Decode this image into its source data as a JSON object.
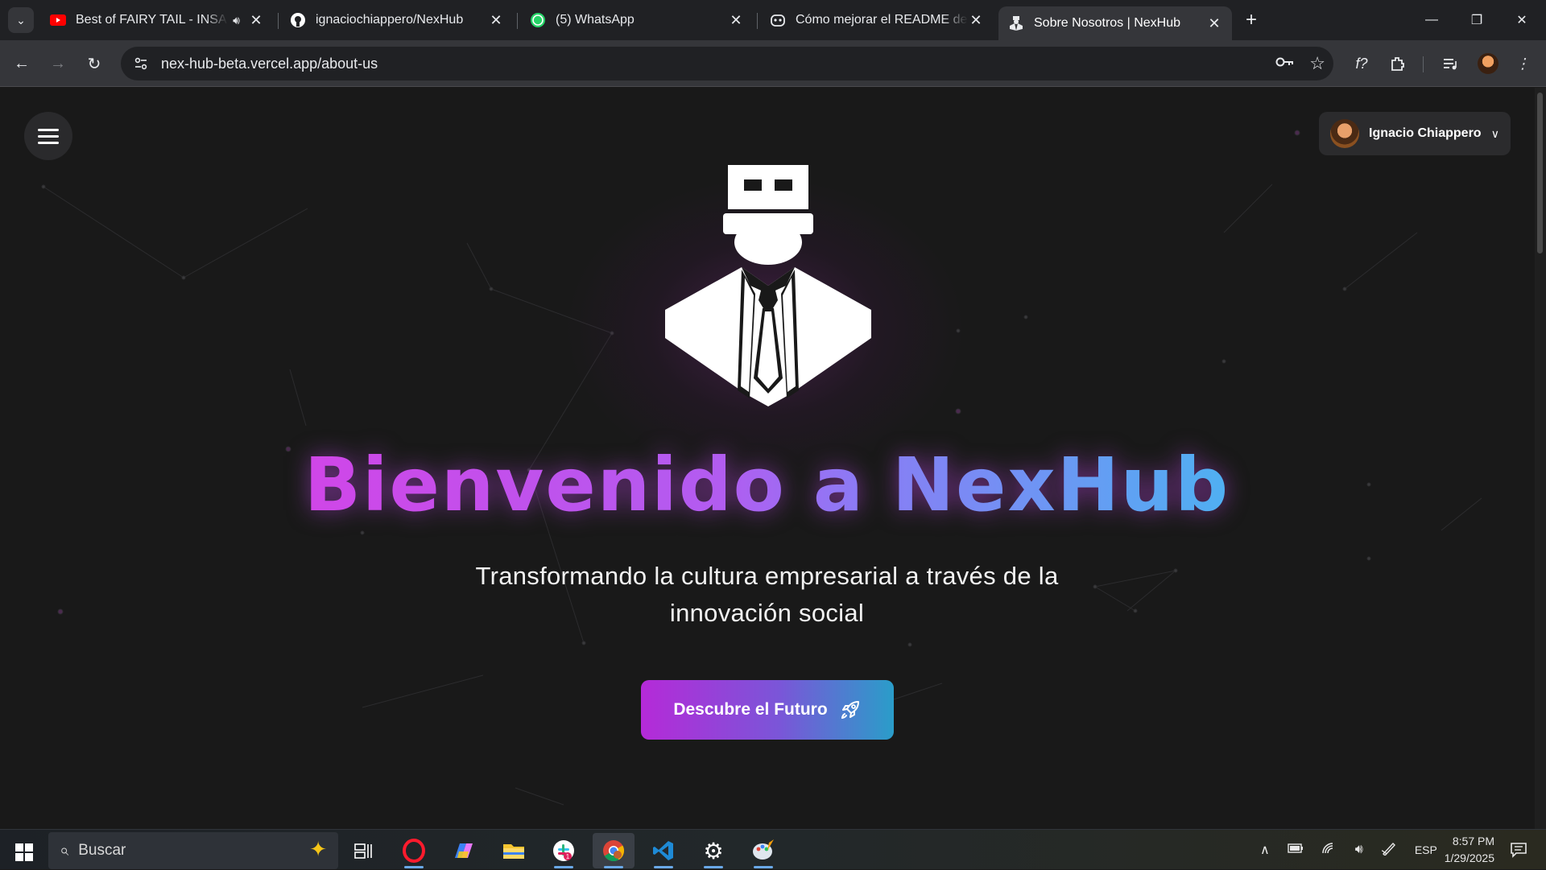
{
  "browser": {
    "tabs": [
      {
        "title": "Best of FAIRY TAIL - INSANE",
        "favicon": "youtube-icon",
        "audio": true,
        "active": false
      },
      {
        "title": "ignaciochiappero/NexHub",
        "favicon": "github-icon",
        "active": false
      },
      {
        "title": "(5) WhatsApp",
        "favicon": "whatsapp-icon",
        "active": false
      },
      {
        "title": "Cómo mejorar el README de un",
        "favicon": "copilot-icon",
        "active": false
      },
      {
        "title": "Sobre Nosotros | NexHub",
        "favicon": "nexhub-icon",
        "active": true
      }
    ],
    "url": "nex-hub-beta.vercel.app/about-us"
  },
  "page": {
    "user_name": "Ignacio Chiappero",
    "hero_title": "Bienvenido a NexHub",
    "hero_subtitle_line1": "Transformando la cultura empresarial a través de la",
    "hero_subtitle_line2": "innovación social",
    "cta_label": "Descubre el Futuro"
  },
  "taskbar": {
    "search_placeholder": "Buscar",
    "language": "ESP",
    "time": "8:57 PM",
    "date": "1/29/2025",
    "apps": [
      "opera-icon",
      "copilot-icon",
      "file-explorer-icon",
      "slack-icon",
      "chrome-icon",
      "vscode-icon",
      "settings-icon",
      "paint-icon"
    ]
  },
  "colors": {
    "title_gradient_start": "#d046e8",
    "title_gradient_end": "#4fb0f2",
    "cta_gradient_start": "#b52ad8",
    "cta_gradient_end": "#2a9dc9",
    "page_background": "#191919"
  }
}
